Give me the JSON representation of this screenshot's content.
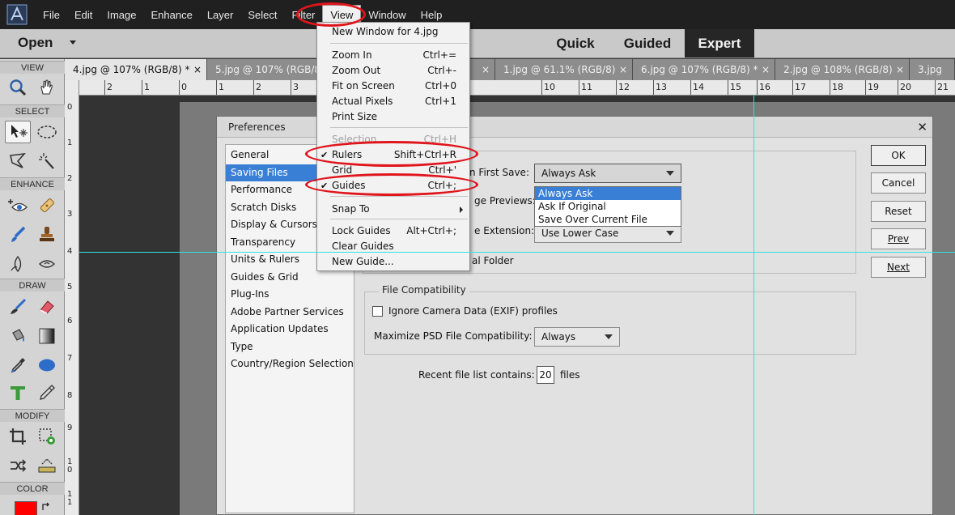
{
  "menubar": {
    "items": [
      "File",
      "Edit",
      "Image",
      "Enhance",
      "Layer",
      "Select",
      "Filter",
      "View",
      "Window",
      "Help"
    ]
  },
  "modebar": {
    "open_label": "Open",
    "modes": [
      "Quick",
      "Guided",
      "Expert"
    ]
  },
  "toolbox": {
    "sections": [
      "VIEW",
      "SELECT",
      "ENHANCE",
      "DRAW",
      "MODIFY",
      "COLOR"
    ],
    "foreground_color": "#ff0000"
  },
  "tabs": [
    "4.jpg @ 107% (RGB/8) *",
    "5.jpg @ 107% (RGB/8)",
    "1.jpg @ 61.1% (RGB/8)",
    "6.jpg @ 107% (RGB/8) *",
    "2.jpg @ 108% (RGB/8)",
    "3.jpg"
  ],
  "tab_close": "×",
  "ruler_h_labels": [
    "2",
    "1",
    "0",
    "1",
    "2",
    "3",
    "10",
    "11",
    "12",
    "13",
    "14",
    "15",
    "16",
    "17",
    "18",
    "19",
    "20",
    "21"
  ],
  "ruler_v_labels": [
    "0",
    "1",
    "2",
    "3",
    "4",
    "5",
    "6",
    "7",
    "8",
    "9",
    "1",
    "0",
    "1",
    "1"
  ],
  "dialog": {
    "title": "Preferences",
    "close_glyph": "✕",
    "categories": [
      "General",
      "Saving Files",
      "Performance",
      "Scratch Disks",
      "Display & Cursors",
      "Transparency",
      "Units & Rulers",
      "Guides & Grid",
      "Plug-Ins",
      "Adobe Partner Services",
      "Application Updates",
      "Type",
      "Country/Region Selection"
    ],
    "save_label_visible": "n First Save:",
    "save_value": "Always Ask",
    "save_options": [
      "Always Ask",
      "Ask If Original",
      "Save Over Current File"
    ],
    "previews_label_visible": "ge Previews:",
    "extension_label_visible": "e Extension:",
    "extension_value": "Use Lower Case",
    "folder_label_visible": "al Folder",
    "compat_group": "File Compatibility",
    "ignore_exif_label": "Ignore Camera Data (EXIF) profiles",
    "psd_label": "Maximize PSD File Compatibility:",
    "psd_value": "Always",
    "recent_label": "Recent file list contains:",
    "recent_value": "20",
    "recent_unit": "files",
    "buttons": [
      "OK",
      "Cancel",
      "Reset",
      "Prev",
      "Next"
    ]
  },
  "view_menu": {
    "new_window": "New Window for 4.jpg",
    "zoom_in": "Zoom In",
    "zoom_in_sc": "Ctrl+=",
    "zoom_out": "Zoom Out",
    "zoom_out_sc": "Ctrl+-",
    "fit": "Fit on Screen",
    "fit_sc": "Ctrl+0",
    "actual": "Actual Pixels",
    "actual_sc": "Ctrl+1",
    "print": "Print Size",
    "selection": "Selection",
    "selection_sc": "Ctrl+H",
    "rulers": "Rulers",
    "rulers_sc": "Shift+Ctrl+R",
    "grid": "Grid",
    "grid_sc": "Ctrl+'",
    "guides": "Guides",
    "guides_sc": "Ctrl+;",
    "snap": "Snap To",
    "lock": "Lock Guides",
    "lock_sc": "Alt+Ctrl+;",
    "clear": "Clear Guides",
    "new_guide": "New Guide...",
    "check_glyph": "✔"
  },
  "colors": {
    "annotation": "#e0151c",
    "guide": "#2fe3e3",
    "selection": "#3a7fd6"
  }
}
